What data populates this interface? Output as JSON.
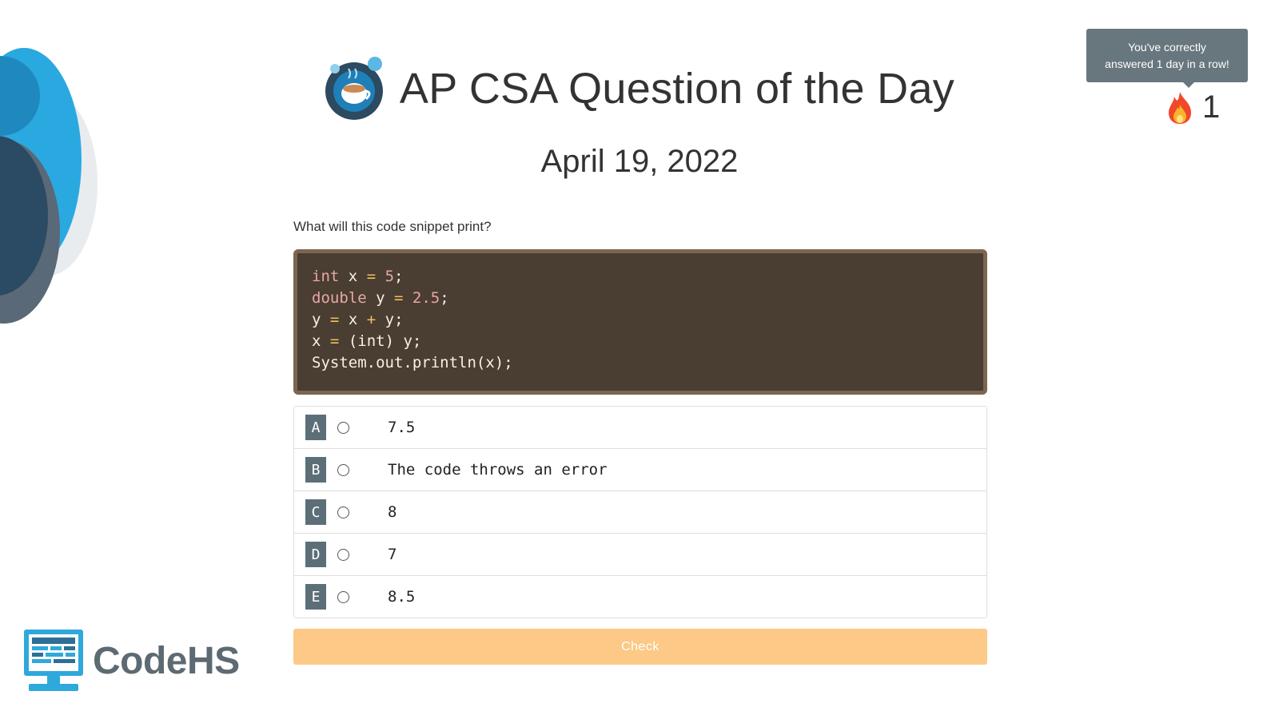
{
  "header": {
    "title": "AP CSA Question of the Day",
    "date": "April 19, 2022"
  },
  "streak": {
    "tooltip_line1": "You've correctly",
    "tooltip_line2": "answered 1 day in a row!",
    "count": "1"
  },
  "question": {
    "prompt": "What will this code snippet print?",
    "code_lines": [
      "int x = 5;",
      "double y = 2.5;",
      "y = x + y;",
      "x = (int) y;",
      "System.out.println(x);"
    ]
  },
  "answers": [
    {
      "letter": "A",
      "text": "7.5"
    },
    {
      "letter": "B",
      "text": "The code throws an error"
    },
    {
      "letter": "C",
      "text": "8"
    },
    {
      "letter": "D",
      "text": "7"
    },
    {
      "letter": "E",
      "text": "8.5"
    }
  ],
  "check_label": "Check",
  "brand": {
    "name": "CodeHS"
  },
  "icons": {
    "logo": "coffee-cup-icon",
    "streak": "flame-icon",
    "brand": "monitor-icon"
  },
  "colors": {
    "code_bg": "#4a3d31",
    "code_border": "#7b6650",
    "letter_badge": "#5c6f78",
    "check_button": "#fcc986",
    "tooltip_bg": "#68777d",
    "brand_blue": "#2fa8dc"
  }
}
